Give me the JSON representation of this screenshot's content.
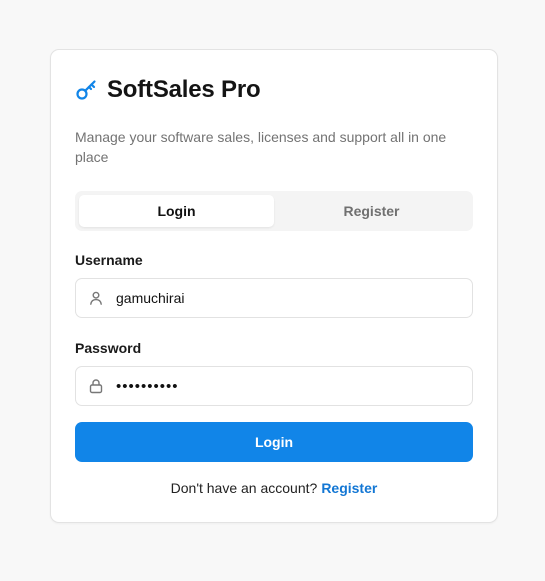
{
  "brand": {
    "title": "SoftSales Pro",
    "icon": "key-icon",
    "accent": "#1185e8"
  },
  "subtitle": "Manage your software sales, licenses and support all in one place",
  "tabs": [
    {
      "label": "Login",
      "active": true
    },
    {
      "label": "Register",
      "active": false
    }
  ],
  "form": {
    "username_label": "Username",
    "username_value": "gamuchirai",
    "password_label": "Password",
    "password_value": "••••••••••",
    "submit_label": "Login"
  },
  "footer": {
    "prompt": "Don't have an account?",
    "link_label": "Register"
  }
}
